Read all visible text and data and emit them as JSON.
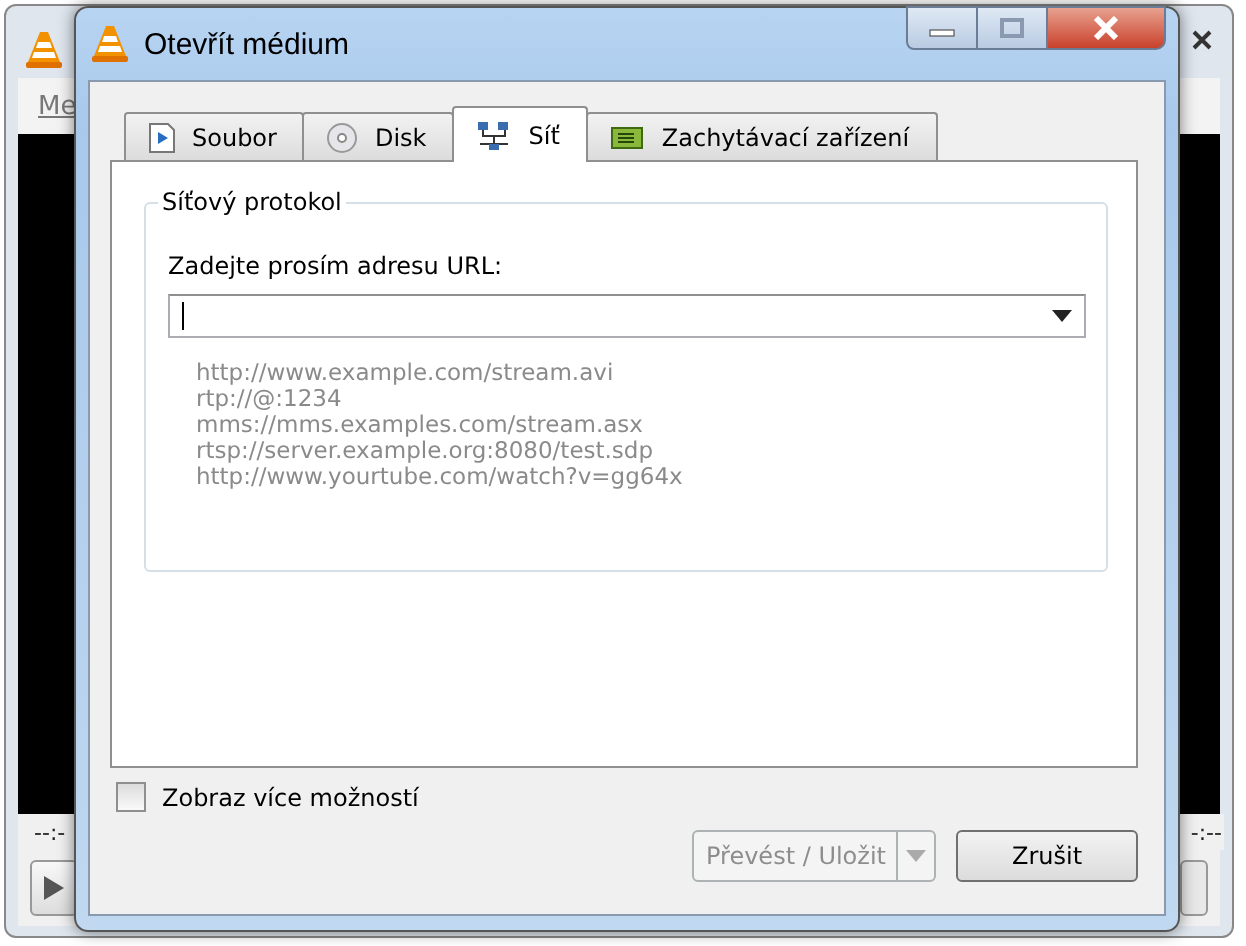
{
  "background_window": {
    "menu_label": "Me",
    "time_elapsed": "--:-",
    "time_total": "-:--"
  },
  "dialog": {
    "title": "Otevřít médium"
  },
  "tabs": [
    {
      "label": "Soubor",
      "kind": "file",
      "selected": false
    },
    {
      "label": "Disk",
      "kind": "disc",
      "selected": false
    },
    {
      "label": "Síť",
      "kind": "network",
      "selected": true
    },
    {
      "label": "Zachytávací zařízení",
      "kind": "capture",
      "selected": false
    }
  ],
  "group": {
    "title": "Síťový protokol",
    "url_label": "Zadejte prosím adresu URL:"
  },
  "examples": [
    "http://www.example.com/stream.avi",
    "rtp://@:1234",
    "mms://mms.examples.com/stream.asx",
    "rtsp://server.example.org:8080/test.sdp",
    "http://www.yourtube.com/watch?v=gg64x"
  ],
  "more_options": {
    "label": "Zobraz více možností",
    "checked": false
  },
  "buttons": [
    {
      "label": "Převést / Uložit",
      "kind": "split",
      "disabled": true
    },
    {
      "label": "Zrušit",
      "kind": "plain",
      "disabled": false
    }
  ]
}
